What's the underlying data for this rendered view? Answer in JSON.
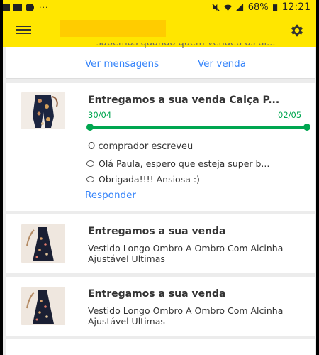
{
  "status_bar": {
    "battery": "68%",
    "time": "12:21",
    "dots": "···"
  },
  "top_card": {
    "partial_text": "sabemos quando quem vendeu os di...",
    "messages_link": "Ver mensagens",
    "sale_link": "Ver venda"
  },
  "sale_card": {
    "title": "Entregamos a sua venda Calça P...",
    "date_start": "30/04",
    "date_end": "02/05",
    "progress": 1.0,
    "buyer_heading": "O comprador escreveu",
    "messages": [
      "Olá Paula, espero que esteja super b...",
      "Obrigada!!!! Ansiosa :)"
    ],
    "reply_link": "Responder"
  },
  "dress_cards": [
    {
      "title": "Entregamos a sua venda",
      "description": "Vestido Longo Ombro A Ombro Com Alcinha Ajustável Ultimas"
    },
    {
      "title": "Entregamos a sua venda",
      "description": "Vestido Longo Ombro A Ombro Com Alcinha Ajustável Ultimas"
    }
  ],
  "colors": {
    "brand_yellow": "#FFE600",
    "link_blue": "#3483FA",
    "progress_green": "#00A650"
  }
}
